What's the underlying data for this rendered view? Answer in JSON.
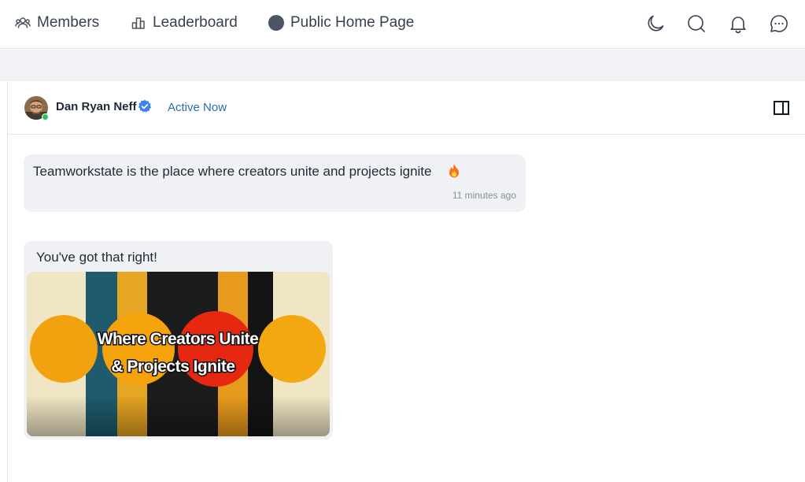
{
  "nav": {
    "members_label": "Members",
    "leaderboard_label": "Leaderboard",
    "public_home_label": "Public Home Page"
  },
  "header_icons": [
    "moon-icon",
    "search-icon",
    "bell-icon",
    "chat-bubble-icon"
  ],
  "conversation": {
    "user_name": "Dan Ryan Neff",
    "status": "Active Now",
    "verified": true,
    "online": true
  },
  "messages": [
    {
      "text": "Teamworkstate is the place where creators unite and projects ignite",
      "emoji": "fire-icon",
      "time": "11 minutes ago"
    },
    {
      "text": "You've got that right!",
      "image_caption_line1": "Where Creators Unite",
      "image_caption_line2": "& Projects Ignite"
    }
  ],
  "colors": {
    "link_blue": "#2b6cb0",
    "verified_blue": "#3b82f6",
    "online_green": "#22c55e",
    "bubble_bg": "#f0f1f4",
    "band_bg": "#f1f2f5"
  }
}
